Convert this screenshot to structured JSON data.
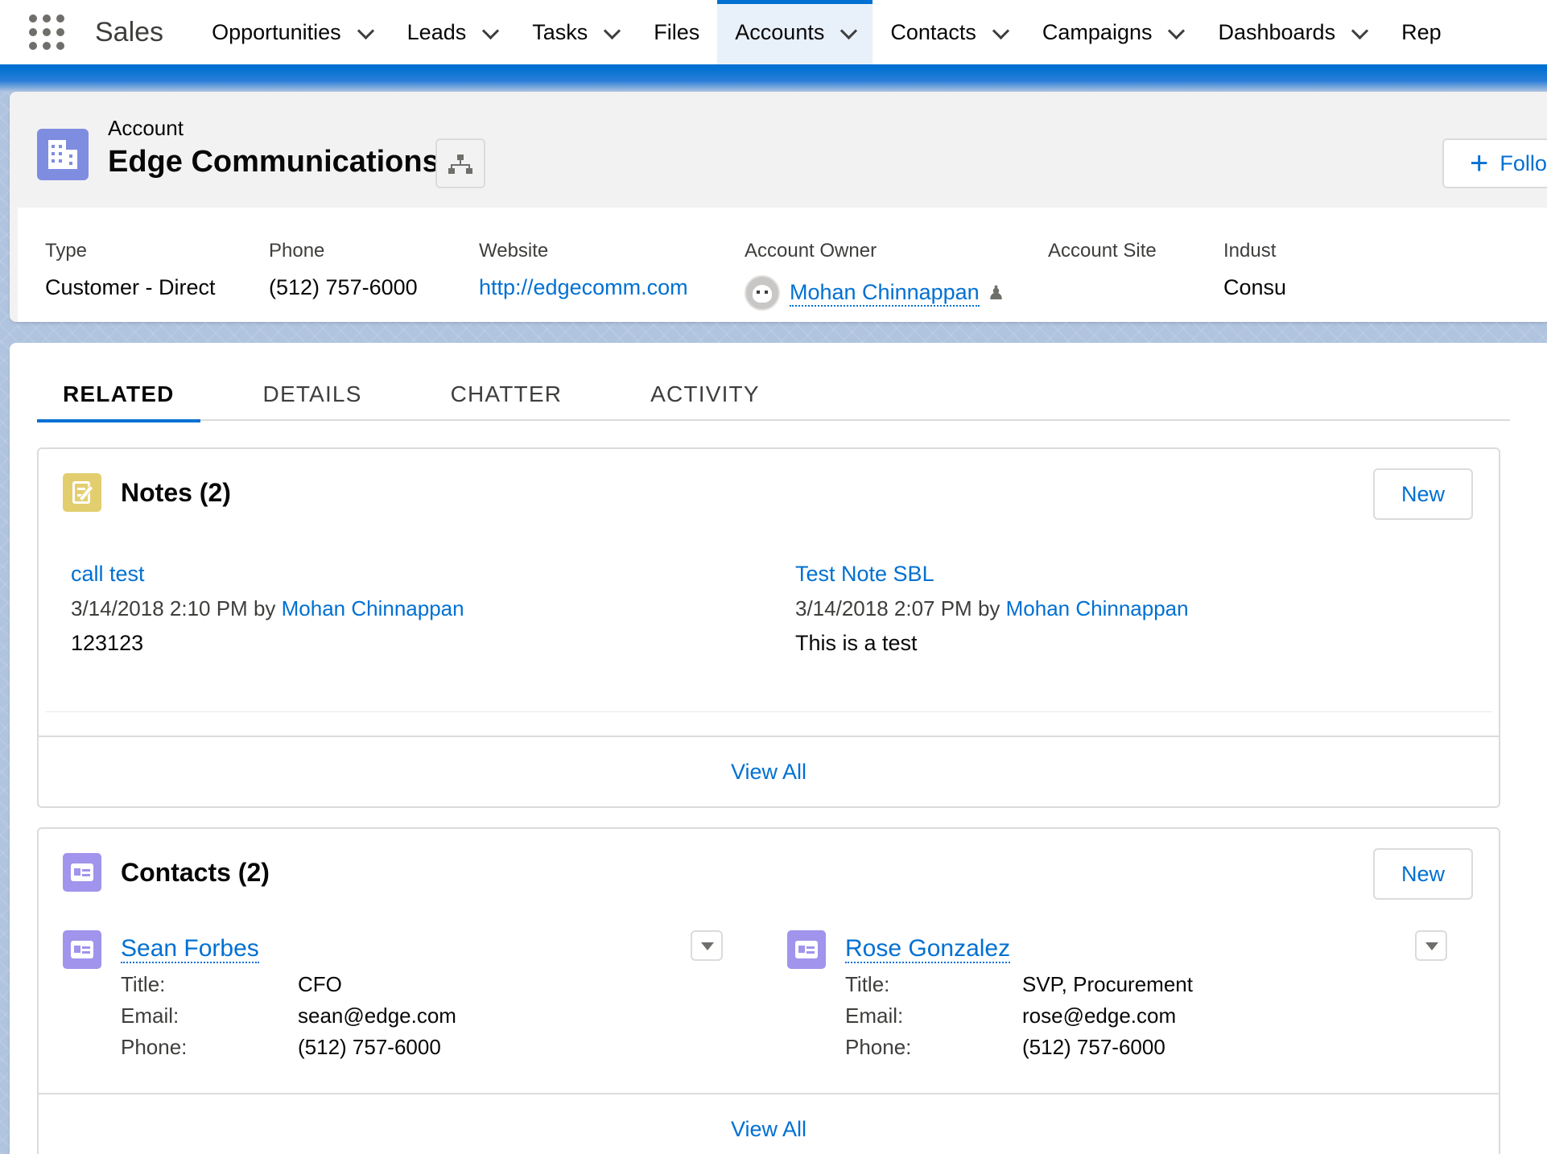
{
  "nav": {
    "app_name": "Sales",
    "items": [
      {
        "label": "Opportunities",
        "chevron": true,
        "active": false
      },
      {
        "label": "Leads",
        "chevron": true,
        "active": false
      },
      {
        "label": "Tasks",
        "chevron": true,
        "active": false
      },
      {
        "label": "Files",
        "chevron": false,
        "active": false
      },
      {
        "label": "Accounts",
        "chevron": true,
        "active": true
      },
      {
        "label": "Contacts",
        "chevron": true,
        "active": false
      },
      {
        "label": "Campaigns",
        "chevron": true,
        "active": false
      },
      {
        "label": "Dashboards",
        "chevron": true,
        "active": false
      },
      {
        "label": "Rep",
        "chevron": false,
        "active": false
      }
    ]
  },
  "header": {
    "object_label": "Account",
    "record_name": "Edge Communications",
    "follow_label": "Follo"
  },
  "highlights": {
    "type_label": "Type",
    "type_value": "Customer - Direct",
    "phone_label": "Phone",
    "phone_value": "(512) 757-6000",
    "website_label": "Website",
    "website_value": "http://edgecomm.com",
    "owner_label": "Account Owner",
    "owner_value": "Mohan Chinnappan",
    "site_label": "Account Site",
    "industry_label": "Indust",
    "industry_value": "Consu"
  },
  "tabs": [
    "RELATED",
    "DETAILS",
    "CHATTER",
    "ACTIVITY"
  ],
  "notes": {
    "title": "Notes (2)",
    "new_label": "New",
    "view_all": "View All",
    "items": [
      {
        "title": "call test",
        "meta_date": "3/14/2018 2:10 PM by",
        "author": "Mohan Chinnappan",
        "body": "123123"
      },
      {
        "title": "Test Note SBL",
        "meta_date": "3/14/2018 2:07 PM by",
        "author": "Mohan Chinnappan",
        "body": "This is a test"
      }
    ]
  },
  "contacts": {
    "title": "Contacts (2)",
    "new_label": "New",
    "view_all": "View All",
    "field_labels": {
      "title": "Title:",
      "email": "Email:",
      "phone": "Phone:"
    },
    "items": [
      {
        "name": "Sean Forbes",
        "title": "CFO",
        "email": "sean@edge.com",
        "phone": "(512) 757-6000"
      },
      {
        "name": "Rose Gonzalez",
        "title": "SVP, Procurement",
        "email": "rose@edge.com",
        "phone": "(512) 757-6000"
      }
    ]
  },
  "colors": {
    "brand": "#0070d2",
    "account_icon": "#7f8de1",
    "notes_icon": "#e3ce6f",
    "contact_icon": "#a094ed"
  },
  "icons": [
    "app-launcher-icon",
    "chevron-down-icon",
    "account-icon",
    "hierarchy-icon",
    "plus-icon",
    "avatar",
    "change-owner-icon",
    "notes-icon",
    "contact-icon"
  ]
}
